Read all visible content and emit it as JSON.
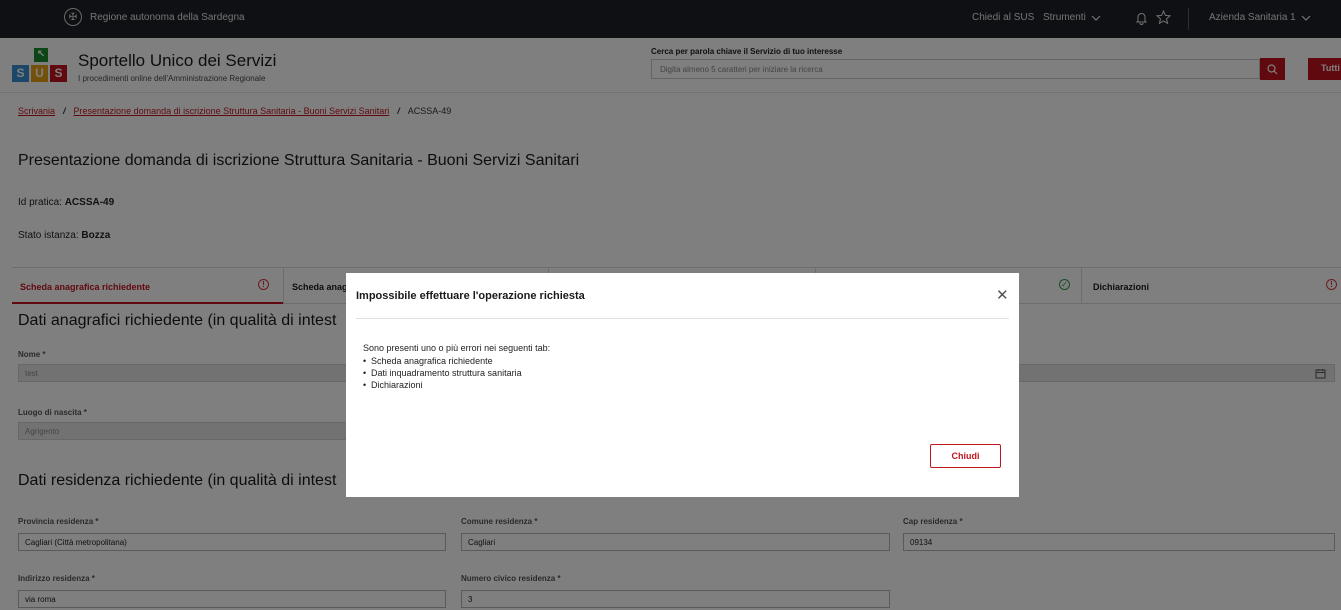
{
  "topbar": {
    "region": "Regione autonoma della Sardegna",
    "chiedi": "Chiedi al SUS",
    "strumenti": "Strumenti",
    "azienda": "Azienda Sanitaria 1"
  },
  "header": {
    "logo_letters": [
      "S",
      "U",
      "S"
    ],
    "title": "Sportello Unico dei Servizi",
    "subtitle": "I procedimenti online dell'Amministrazione Regionale",
    "search_label": "Cerca per parola chiave il Servizio di tuo interesse",
    "search_placeholder": "Digita almeno 5 caratteri per iniziare la ricerca",
    "tutti": "Tutti"
  },
  "breadcrumb": {
    "home": "Scrivania",
    "parent": "Presentazione domanda di iscrizione Struttura Sanitaria - Buoni Servizi Sanitari",
    "current": "ACSSA-49"
  },
  "page": {
    "title": "Presentazione domanda di iscrizione Struttura Sanitaria - Buoni Servizi Sanitari",
    "id_label": "Id pratica:",
    "id_value": "ACSSA-49",
    "stato_label": "Stato istanza:",
    "stato_value": "Bozza"
  },
  "tabs": [
    {
      "label": "Scheda anagrafica richiedente",
      "status": "error"
    },
    {
      "label": "Scheda anag",
      "status": "none"
    },
    {
      "label": "Dichiarazioni",
      "status": "error"
    }
  ],
  "section1": {
    "title": "Dati anagrafici richiedente (in qualità di intest",
    "nome_label": "Nome *",
    "nome_value": "test",
    "luogo_label": "Luogo di nascita *",
    "luogo_value": "Agrigento"
  },
  "section2": {
    "title": "Dati residenza richiedente (in qualità di intest",
    "provincia_label": "Provincia residenza *",
    "provincia_value": "Cagliari (Città metropolitana)",
    "comune_label": "Comune residenza *",
    "comune_value": "Cagliari",
    "cap_label": "Cap residenza *",
    "cap_value": "09134",
    "indirizzo_label": "Indirizzo residenza *",
    "indirizzo_value": "via roma",
    "civico_label": "Numero civico residenza *",
    "civico_value": "3"
  },
  "modal": {
    "title": "Impossibile effettuare l'operazione richiesta",
    "message": "Sono presenti uno o più errori nei seguenti tab:",
    "errors": [
      "Scheda anagrafica richiedente",
      "Dati inquadramento struttura sanitaria",
      "Dichiarazioni"
    ],
    "close_label": "Chiudi"
  },
  "colors": {
    "accent": "#c0151f",
    "topbar": "#1c2126",
    "error": "#d9363e",
    "success": "#2e9a4a"
  },
  "icons": [
    "region-crest-icon",
    "chevron-down-icon",
    "bell-icon",
    "star-icon",
    "search-icon",
    "error-circle-icon",
    "check-circle-icon",
    "calendar-icon",
    "close-icon"
  ]
}
